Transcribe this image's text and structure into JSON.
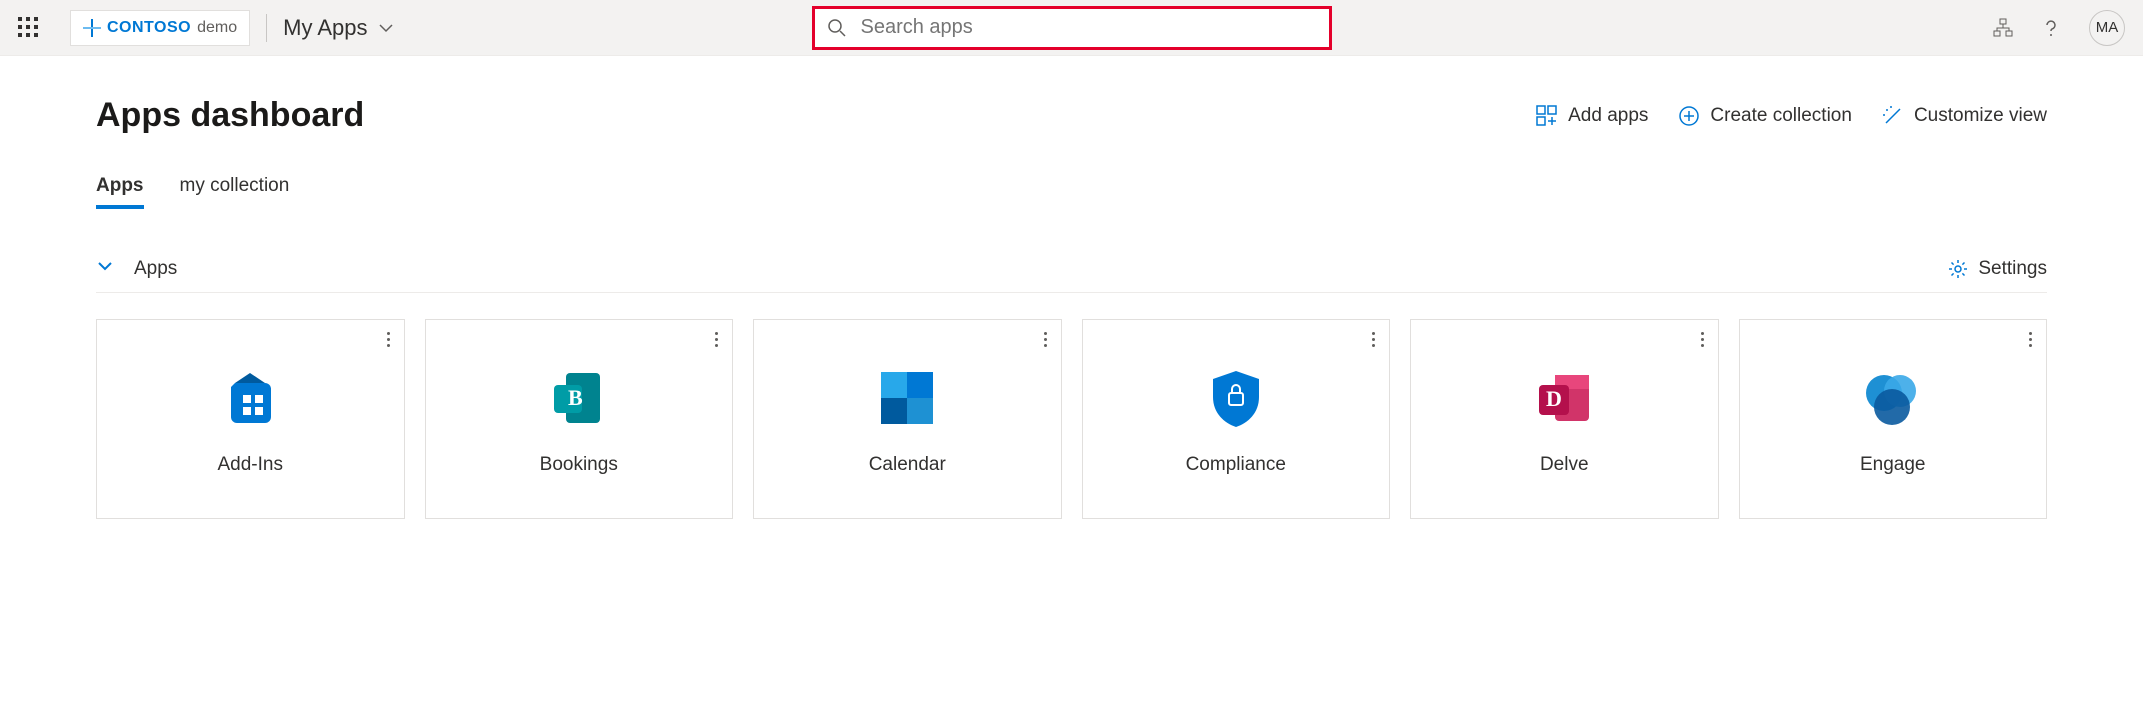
{
  "header": {
    "brand_name": "CONTOSO",
    "brand_suffix": "demo",
    "view_label": "My Apps",
    "search_placeholder": "Search apps",
    "avatar_initials": "MA"
  },
  "page": {
    "title": "Apps dashboard"
  },
  "actions": {
    "add_apps": "Add apps",
    "create_collection": "Create collection",
    "customize_view": "Customize view"
  },
  "tabs": [
    {
      "label": "Apps",
      "active": true
    },
    {
      "label": "my collection",
      "active": false
    }
  ],
  "section": {
    "title": "Apps",
    "settings_label": "Settings"
  },
  "apps": [
    {
      "name": "Add-Ins",
      "icon": "addins"
    },
    {
      "name": "Bookings",
      "icon": "bookings"
    },
    {
      "name": "Calendar",
      "icon": "calendar"
    },
    {
      "name": "Compliance",
      "icon": "compliance"
    },
    {
      "name": "Delve",
      "icon": "delve"
    },
    {
      "name": "Engage",
      "icon": "engage"
    }
  ],
  "colors": {
    "accent": "#0078d4",
    "highlight_border": "#e4002b"
  }
}
